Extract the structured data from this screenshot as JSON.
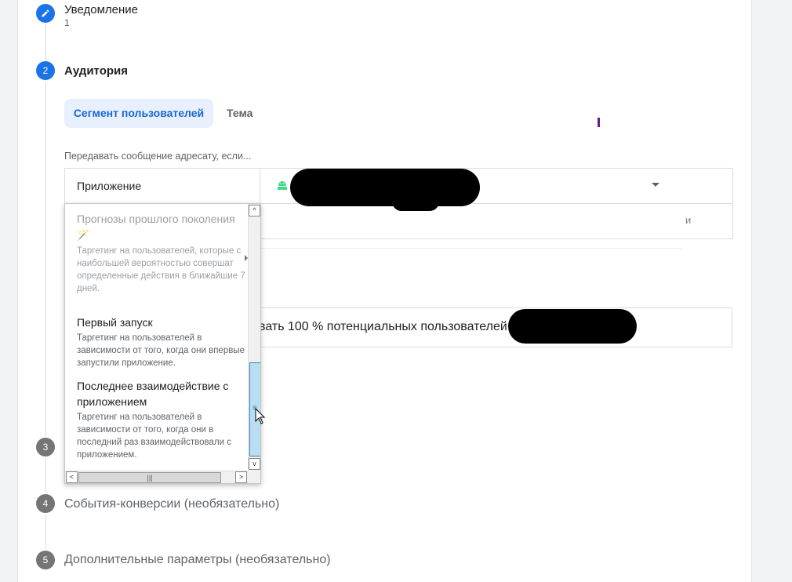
{
  "steps": [
    {
      "number": "",
      "title": "Уведомление",
      "subtitle": "1"
    },
    {
      "number": "2",
      "title": "Аудитория"
    },
    {
      "number": "3",
      "title": ""
    },
    {
      "number": "4",
      "title": "События-конверсии (необязательно)"
    },
    {
      "number": "5",
      "title": "Дополнительные параметры (необязательно)"
    }
  ],
  "audience": {
    "tabs": [
      "Сегмент пользователей",
      "Тема"
    ],
    "hint": "Передавать сообщение адресату, если...",
    "condition_label": "Приложение",
    "and_label": "и",
    "reach_text": "вать 100 % потенциальных пользователей"
  },
  "dropdown": {
    "options": [
      {
        "title": "Прогнозы прошлого поколения",
        "icon": "magic-wand-icon",
        "description": "Таргетинг на пользователей, которые с наибольшей вероятностью совершат определенные действия в ближайшие 7 дней.",
        "disabled": true
      },
      {
        "title": "Первый запуск",
        "description": "Таргетинг на пользователей в зависимости от того, когда они впервые запустили приложение."
      },
      {
        "title": "Последнее взаимодействие с приложением",
        "description": "Таргетинг на пользователей в зависимости от того, когда они в последний раз взаимодействовали с приложением."
      }
    ],
    "vscroll_position": 0.72,
    "hscroll_position": 0.0
  },
  "colors": {
    "accent": "#1a73e8",
    "tab_bg": "#e8f0fe",
    "android": "#3ddc84",
    "scroll_thumb": "#b9ddf3"
  }
}
